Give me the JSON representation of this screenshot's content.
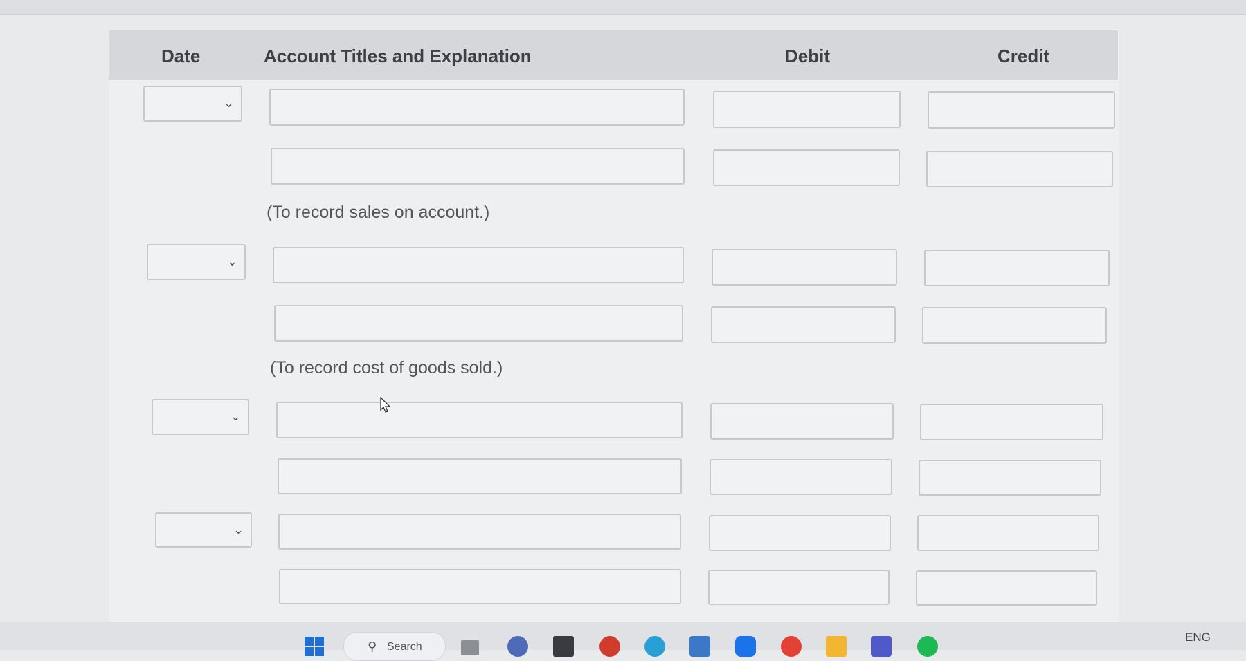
{
  "table": {
    "headers": {
      "date": "Date",
      "account": "Account Titles and Explanation",
      "debit": "Debit",
      "credit": "Credit"
    },
    "explanations": {
      "sales": "(To record sales on account.)",
      "cogs": "(To record cost of goods sold.)"
    }
  },
  "taskbar": {
    "search_label": "Search",
    "language": "ENG"
  },
  "colors": {
    "header_bg": "#d6d7da",
    "field_border": "#c6c8cc",
    "panel_bg": "#eeeff1"
  }
}
